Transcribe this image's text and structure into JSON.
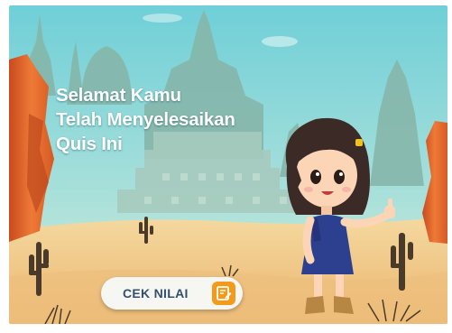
{
  "screen": {
    "headline_lines": [
      "Selamat  Kamu",
      "Telah Menyelesaikan",
      "Quis Ini"
    ]
  },
  "cta_button": {
    "label": "CEK NILAI",
    "icon": "edit-note-icon"
  },
  "colors": {
    "sky_top": "#7fd3d9",
    "sky_bottom": "#bfe7dc",
    "temple": "#8fb9ad",
    "sand": "#f2c98a",
    "rock": "#e56b2e",
    "accent": "#f39a1a",
    "button_text": "#34506a"
  }
}
